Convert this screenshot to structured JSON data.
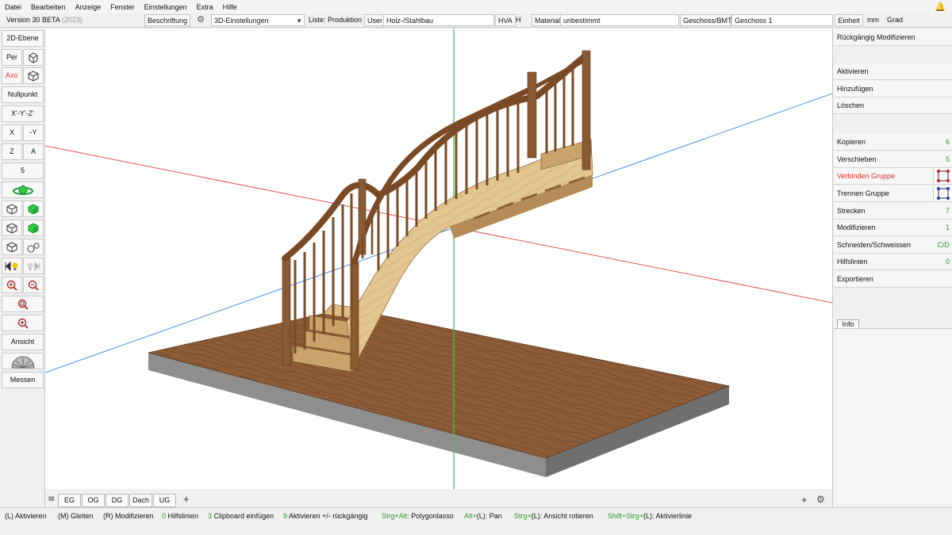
{
  "menu": [
    "Datei",
    "Bearbeiten",
    "Anzeige",
    "Fenster",
    "Einstellungen",
    "Extra",
    "Hilfe"
  ],
  "toolbar": {
    "version": "Version 30 BETA",
    "version_year": "(2023)",
    "beschriftung": "Beschriftung",
    "view_setting": "3D-Einstellungen",
    "liste": "Liste: Produktion",
    "user": "User",
    "material_type": "Holz-/Stahlbau",
    "hva": "HVA",
    "h": "H",
    "material_label": "Material",
    "material_value": "unbestimmt",
    "geschoss_label": "Geschoss/BMT",
    "geschoss_value": "Geschoss 1",
    "einheit": "Einheit",
    "unit_length": "mm",
    "unit_angle": "Grad"
  },
  "left_tools": {
    "ebene": "2D-Ebene",
    "per": "Per",
    "axo": "Axo",
    "nullpunkt": "Nullpunkt",
    "xyz": "X'-Y'-Z'",
    "x": "X",
    "neg_y": "-Y",
    "z": "Z",
    "a": "A",
    "five": "5",
    "ansicht": "Ansicht",
    "messen": "Messen"
  },
  "floor_tabs": [
    "EG",
    "OG",
    "DG",
    "Dach",
    "UG"
  ],
  "right_actions": [
    {
      "label": "Rückgängig Modifizieren",
      "count": ""
    },
    {
      "label": "Aktivieren",
      "count": ""
    },
    {
      "label": "Hinzufügen",
      "count": ""
    },
    {
      "label": "Löschen",
      "count": ""
    },
    {
      "label": "Kopieren",
      "count": "6"
    },
    {
      "label": "Verschieben",
      "count": "5"
    },
    {
      "label": "Verbinden Gruppe",
      "count": ""
    },
    {
      "label": "Trennen Gruppe",
      "count": ""
    },
    {
      "label": "Strecken",
      "count": "7"
    },
    {
      "label": "Modifizieren",
      "count": "1"
    },
    {
      "label": "Schneiden/Schweissen",
      "count": "C/D"
    },
    {
      "label": "Hilfslinien",
      "count": "0"
    },
    {
      "label": "Exportieren",
      "count": ""
    }
  ],
  "info_tab": "Info",
  "status_hints": [
    {
      "key": "",
      "text": "(L) Aktivieren"
    },
    {
      "key": "",
      "text": "(M) Gleiten"
    },
    {
      "key": "",
      "text": "(R) Modifizieren"
    },
    {
      "key": "0",
      "text": "Hilfslinien"
    },
    {
      "key": "3",
      "text": "Clipboard einfügen"
    },
    {
      "key": "9",
      "text": "Aktivieren +/- rückgängig"
    },
    {
      "key": "Strg+Alt:",
      "text": "Polygonlasso"
    },
    {
      "key": "Alt+",
      "text": "(L): Pan"
    },
    {
      "key": "Strg+",
      "text": "(L): Ansicht rotieren"
    },
    {
      "key": "Shift+Strg+",
      "text": "(L): Aktivierlinie"
    }
  ],
  "colors": {
    "axis_red": "#e05050",
    "axis_blue": "#4a8ee0",
    "axis_green": "#2ecc40",
    "floor_wood": "#8a5a36",
    "wood_light": "#e2c58e",
    "wood_dark": "#7a4f2c"
  }
}
